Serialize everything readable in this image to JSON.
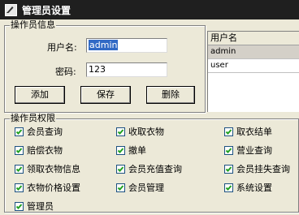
{
  "window": {
    "title": "管理员设置"
  },
  "info_group": {
    "legend": "操作员信息",
    "username_label": "用户名:",
    "username_value": "admin",
    "password_label": "密码:",
    "password_value": "123",
    "buttons": {
      "add": "添加",
      "save": "保存",
      "delete": "删除"
    }
  },
  "user_list": {
    "header": "用户名",
    "rows": [
      "admin",
      "user"
    ],
    "selected_index": 0
  },
  "permissions": {
    "legend": "操作员权限",
    "items": [
      {
        "label": "会员查询",
        "checked": true
      },
      {
        "label": "收取衣物",
        "checked": true
      },
      {
        "label": "取衣结单",
        "checked": true
      },
      {
        "label": "赔偿衣物",
        "checked": true
      },
      {
        "label": "撤单",
        "checked": true
      },
      {
        "label": "营业查询",
        "checked": true
      },
      {
        "label": "领取衣物信息",
        "checked": true
      },
      {
        "label": "会员充值查询",
        "checked": true
      },
      {
        "label": "会员挂失查询",
        "checked": true
      },
      {
        "label": "衣物价格设置",
        "checked": true
      },
      {
        "label": "会员管理",
        "checked": true
      },
      {
        "label": "系统设置",
        "checked": true
      },
      {
        "label": "管理员",
        "checked": true
      }
    ]
  },
  "colors": {
    "titlebar": "#1f1f1f",
    "face": "#ece9d8",
    "selection": "#316ac5",
    "check": "#21a121"
  }
}
